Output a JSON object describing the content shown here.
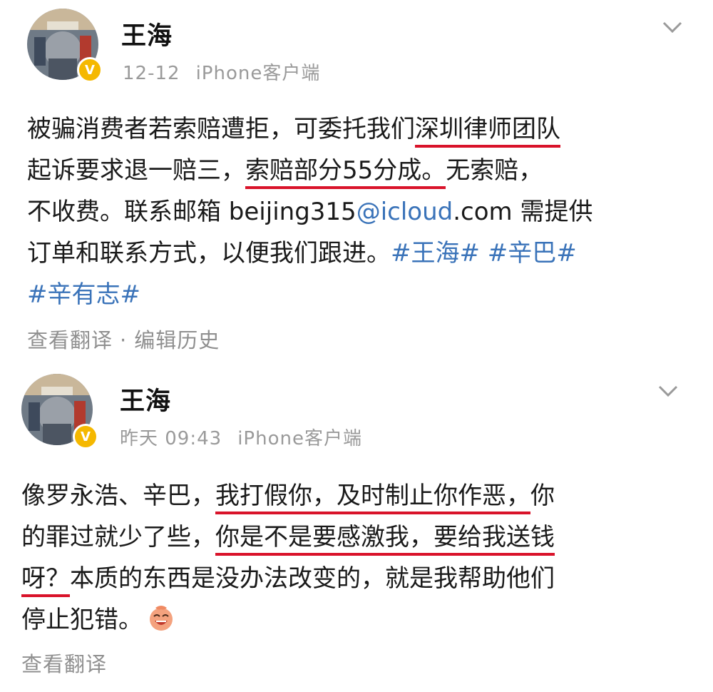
{
  "posts": [
    {
      "author": "王海",
      "date": "12-12",
      "source": "iPhone客户端",
      "verified_badge": "V",
      "body": {
        "l1a": "被骗消费者若索赔遭拒，可委托我们",
        "l1b": "深圳律师团队",
        "l2a": "起诉要求退一赔三，",
        "l2b": "索赔部分55分成。",
        "l2c": "无索赔，",
        "l3a": "不收费。联系邮箱 beijing315",
        "l3b": "@icloud",
        "l3c": ".com 需提供",
        "l4a": "订单和联系方式，以便我们跟进。",
        "l4b": "#王海#",
        "l4c": "#辛巴#",
        "l5a": "#辛有志#"
      },
      "actions": {
        "translate": "查看翻译",
        "separator": "·",
        "edit_history": "编辑历史"
      }
    },
    {
      "author": "王海",
      "date": "昨天 09:43",
      "source": "iPhone客户端",
      "verified_badge": "V",
      "body": {
        "l1a": "像罗永浩、辛巴，",
        "l1b": "我打假你，及时制止你作恶，",
        "l1c": "你",
        "l2a": "的罪过就少了些，",
        "l2b": "你是不是要感激我，要给我送钱",
        "l3a": "呀？",
        "l3b": "本质的东西是没办法改变的，就是我帮助他们",
        "l4a": "停止犯错。"
      },
      "emoji_icon": "laughing-face-emoji",
      "actions": {
        "translate": "查看翻译"
      }
    }
  ],
  "colors": {
    "link": "#3a73b9",
    "underline": "#d9132a",
    "badge": "#f5b800",
    "meta": "#9a9a9a"
  }
}
